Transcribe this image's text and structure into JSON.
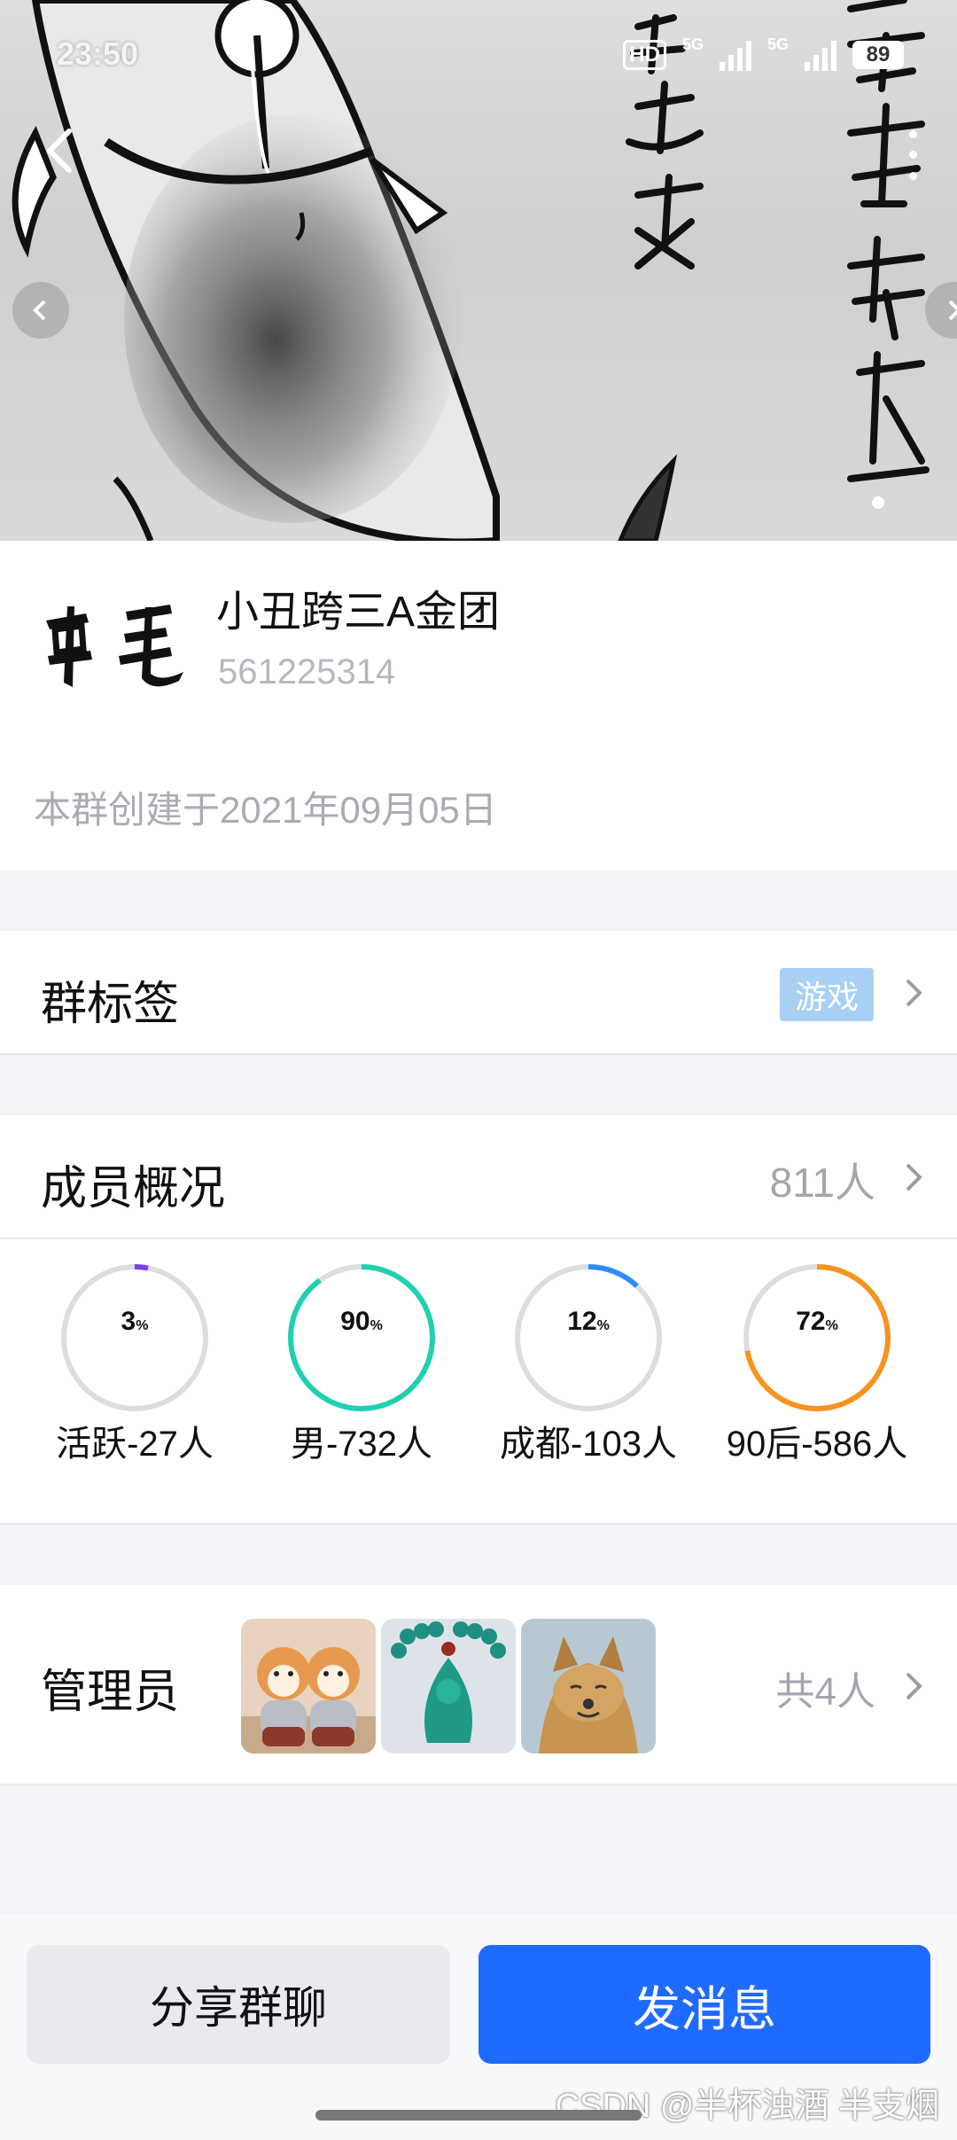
{
  "status_bar": {
    "time": "23:50",
    "hd": "HD",
    "net1": "5G",
    "net2": "5G",
    "battery": "89"
  },
  "group": {
    "logo_text": "吊毛",
    "name": "小丑跨三A金团",
    "id": "561225314",
    "created": "本群创建于2021年09月05日"
  },
  "tags_row": {
    "title": "群标签",
    "tag": "游戏"
  },
  "members": {
    "title": "成员概况",
    "count": "811人",
    "stats": [
      {
        "percent": "3",
        "unit": "%",
        "label": "活跃-27人",
        "value": 3,
        "color": "#7B3FF2"
      },
      {
        "percent": "90",
        "unit": "%",
        "label": "男-732人",
        "value": 90,
        "color": "#1FD1B0"
      },
      {
        "percent": "12",
        "unit": "%",
        "label": "成都-103人",
        "value": 12,
        "color": "#2D8CFF"
      },
      {
        "percent": "72",
        "unit": "%",
        "label": "90后-586人",
        "value": 72,
        "color": "#F7931E"
      }
    ]
  },
  "admins": {
    "title": "管理员",
    "total": "共4人"
  },
  "actions": {
    "share": "分享群聊",
    "send": "发消息"
  },
  "watermark": "CSDN @半杯浊酒 半支烟",
  "icons": {
    "back": "chevron-left-icon",
    "more": "more-vertical-icon",
    "chevron": "chevron-right-icon"
  }
}
